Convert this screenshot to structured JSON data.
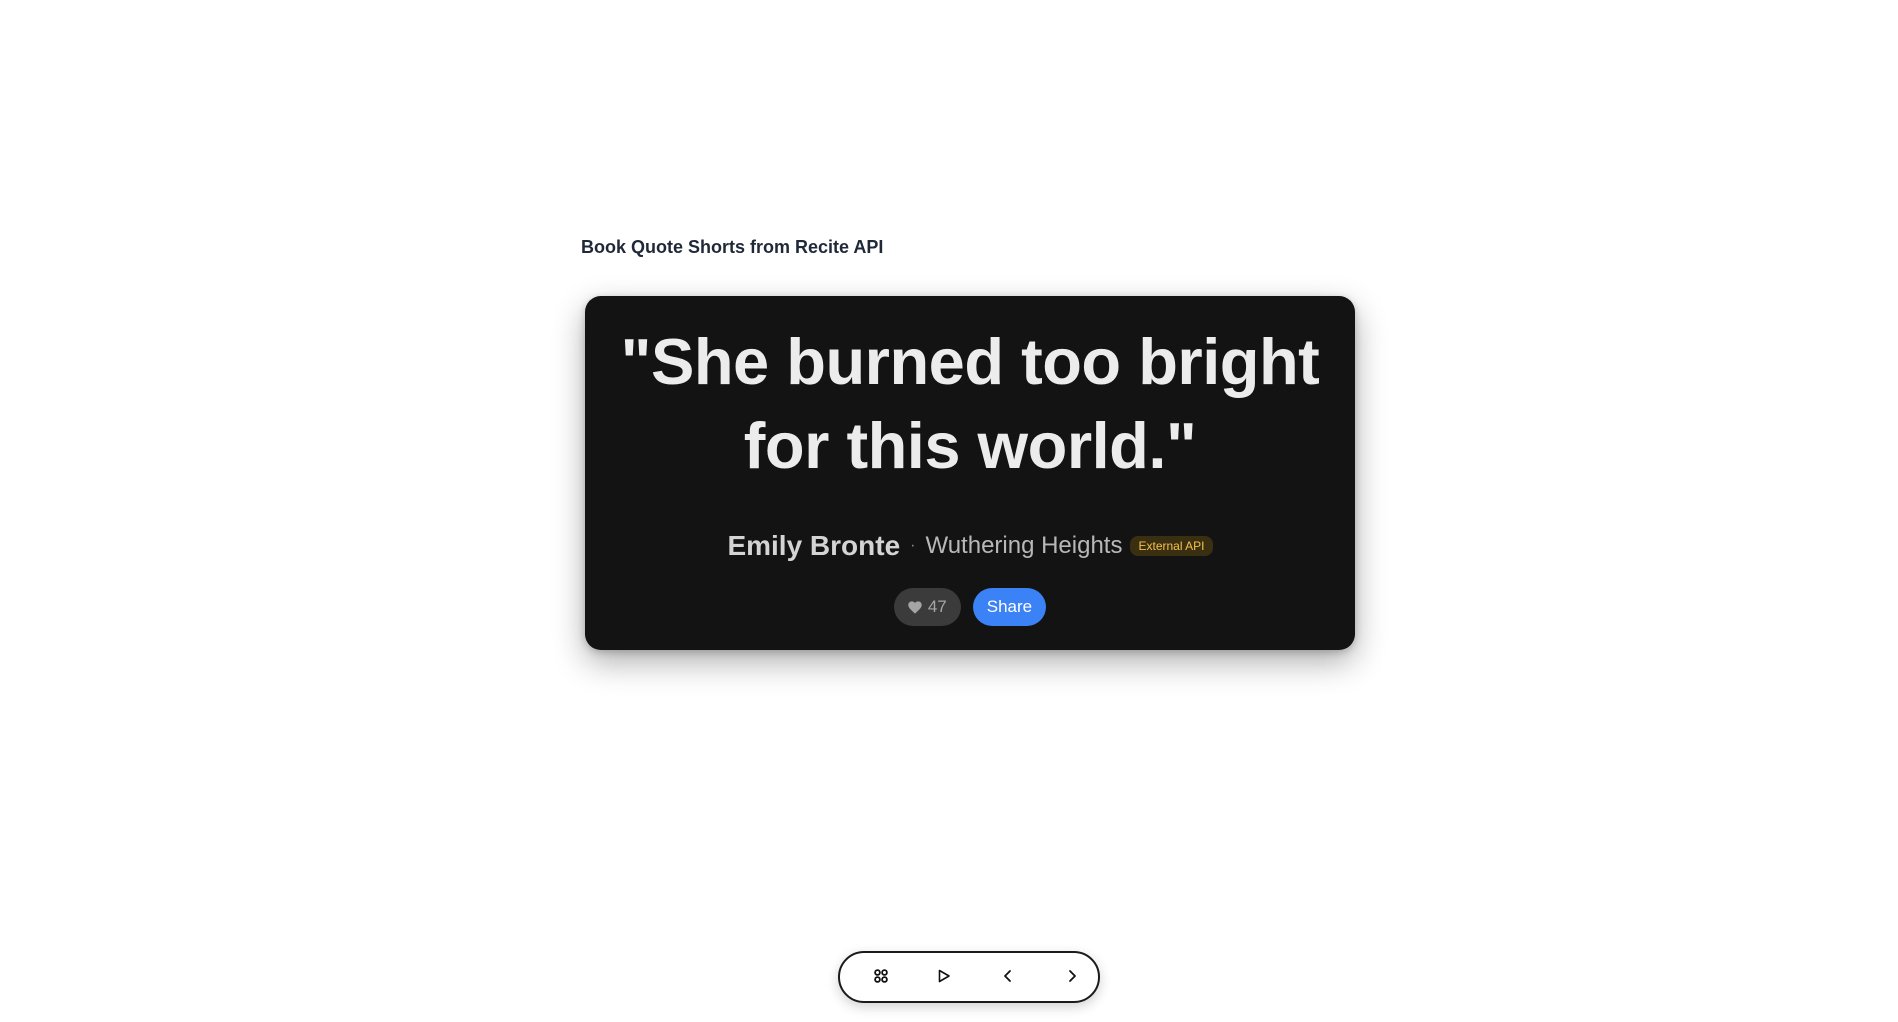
{
  "page": {
    "title": "Book Quote Shorts from Recite API"
  },
  "quote_card": {
    "quote": "\"She burned too bright for this world.\"",
    "author": "Emily Bronte",
    "separator": "·",
    "book": "Wuthering Heights",
    "badge": "External API",
    "likes": "47",
    "share_label": "Share"
  },
  "toolbar": {
    "items": [
      {
        "icon": "grid-icon"
      },
      {
        "icon": "play-icon"
      },
      {
        "icon": "chevron-left-icon"
      },
      {
        "icon": "chevron-right-icon"
      }
    ]
  },
  "colors": {
    "card_bg": "#131313",
    "accent": "#3b82f6",
    "badge_text": "#f2c14a"
  }
}
